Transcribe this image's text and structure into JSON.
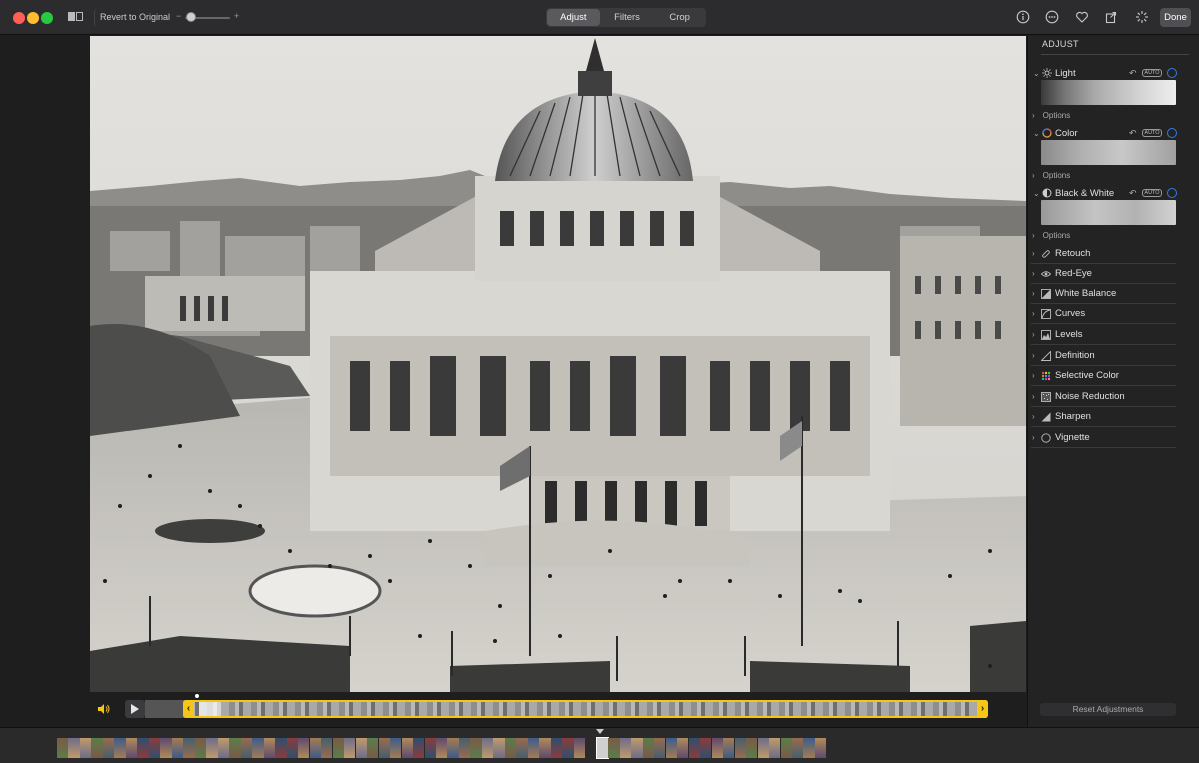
{
  "toolbar": {
    "revert_label": "Revert to Original",
    "zoom_minus": "−",
    "zoom_plus": "+",
    "tabs": [
      {
        "label": "Adjust",
        "active": true
      },
      {
        "label": "Filters",
        "active": false
      },
      {
        "label": "Crop",
        "active": false
      }
    ],
    "icons": [
      "info-icon",
      "more-icon",
      "heart-icon",
      "share-icon",
      "auto-enhance-icon"
    ],
    "done_label": "Done"
  },
  "panel": {
    "title": "ADJUST",
    "sections": [
      {
        "label": "Light",
        "icon": "sun-icon",
        "auto": "AUTO",
        "options": "Options"
      },
      {
        "label": "Color",
        "icon": "color-wheel-icon",
        "auto": "AUTO",
        "options": "Options"
      },
      {
        "label": "Black & White",
        "icon": "half-circle-icon",
        "auto": "AUTO",
        "options": "Options"
      }
    ],
    "tools": [
      {
        "label": "Retouch",
        "icon": "bandage-icon"
      },
      {
        "label": "Red-Eye",
        "icon": "eye-icon"
      },
      {
        "label": "White Balance",
        "icon": "white-balance-icon"
      },
      {
        "label": "Curves",
        "icon": "curves-icon"
      },
      {
        "label": "Levels",
        "icon": "levels-icon"
      },
      {
        "label": "Definition",
        "icon": "definition-icon"
      },
      {
        "label": "Selective Color",
        "icon": "selective-color-icon"
      },
      {
        "label": "Noise Reduction",
        "icon": "noise-icon"
      },
      {
        "label": "Sharpen",
        "icon": "sharpen-icon"
      },
      {
        "label": "Vignette",
        "icon": "vignette-icon"
      }
    ],
    "reset_label": "Reset Adjustments"
  },
  "colors": {
    "accent": "#2f7ee8",
    "trim": "#f5c518",
    "panel_bg": "#232323"
  }
}
